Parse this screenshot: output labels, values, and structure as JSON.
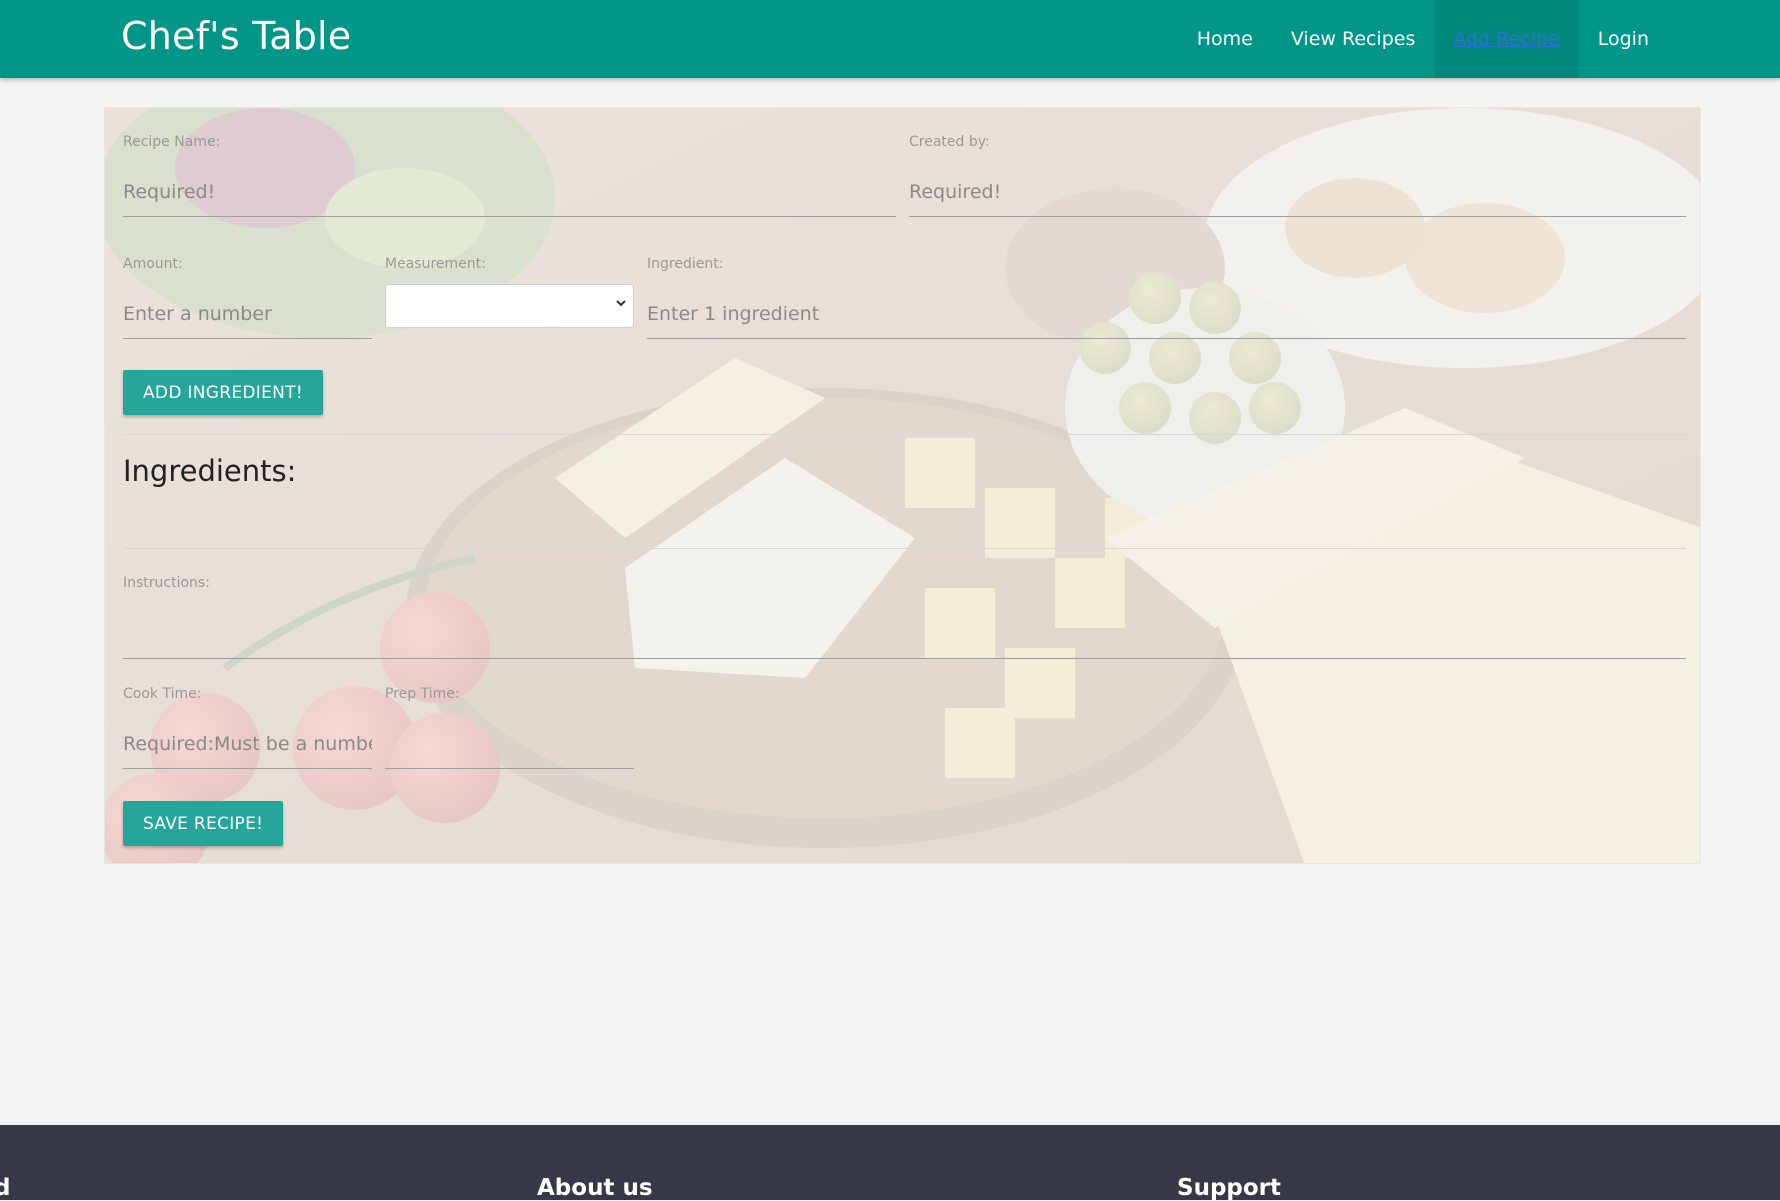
{
  "navbar": {
    "brand": "Chef's Table",
    "links": [
      "Home",
      "View Recipes",
      "Add Recipe",
      "Login"
    ],
    "active_link": "Add Recipe"
  },
  "form": {
    "recipe_name": {
      "label": "Recipe Name:",
      "placeholder": "Required!"
    },
    "created_by": {
      "label": "Created by:",
      "placeholder": "Required!"
    },
    "amount": {
      "label": "Amount:",
      "placeholder": "Enter a number"
    },
    "measurement": {
      "label": "Measurement:",
      "value": ""
    },
    "ingredient": {
      "label": "Ingredient:",
      "placeholder": "Enter 1 ingredient"
    },
    "add_ingredient_button": "ADD INGREDIENT!",
    "ingredients_heading": "Ingredients:",
    "instructions": {
      "label": "Instructions:",
      "placeholder": ""
    },
    "cook_time": {
      "label": "Cook Time:",
      "placeholder": "Required:Must be a number."
    },
    "prep_time": {
      "label": "Prep Time:",
      "placeholder": ""
    },
    "save_button": "SAVE RECIPE!"
  },
  "footer": {
    "col1_partial": "d",
    "col2": "About us",
    "col3": "Support"
  },
  "colors": {
    "primary": "#009688",
    "button": "#26a69a",
    "footer": "#363848",
    "background": "#f4f4f4"
  },
  "icons": {
    "select_arrow": "chevron-down-icon"
  }
}
